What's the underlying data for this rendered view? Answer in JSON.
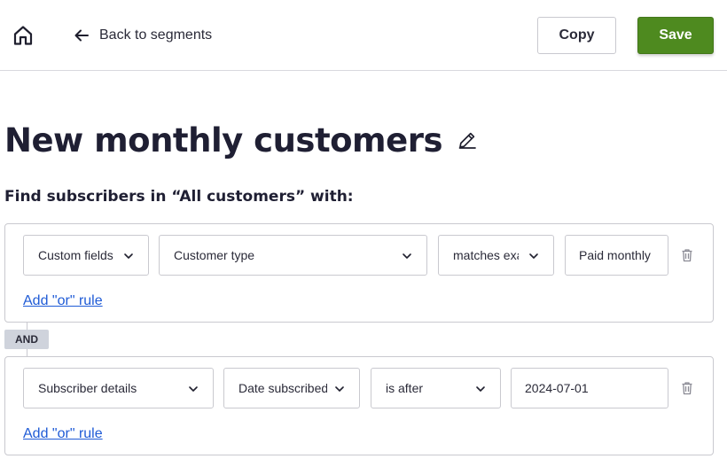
{
  "header": {
    "home_icon": "home-icon",
    "back_icon": "arrow-left-icon",
    "back_label": "Back to segments",
    "copy_label": "Copy",
    "save_label": "Save",
    "save_color": "#4e8a1f"
  },
  "segment": {
    "title": "New monthly customers",
    "edit_icon": "pencil-icon",
    "subtitle": "Find subscribers in “All customers” with:"
  },
  "groups": [
    {
      "rules": [
        {
          "field_category": "Custom fields",
          "field": "Customer type",
          "operator": "matches exactly",
          "value": "Paid monthly"
        }
      ],
      "add_or_label": "Add \"or\" rule"
    },
    {
      "rules": [
        {
          "field_category": "Subscriber details",
          "field": "Date subscribed",
          "operator": "is after",
          "value": "2024-07-01"
        }
      ],
      "add_or_label": "Add \"or\" rule"
    }
  ],
  "connector_label": "AND",
  "link_color": "#1f5bd6"
}
